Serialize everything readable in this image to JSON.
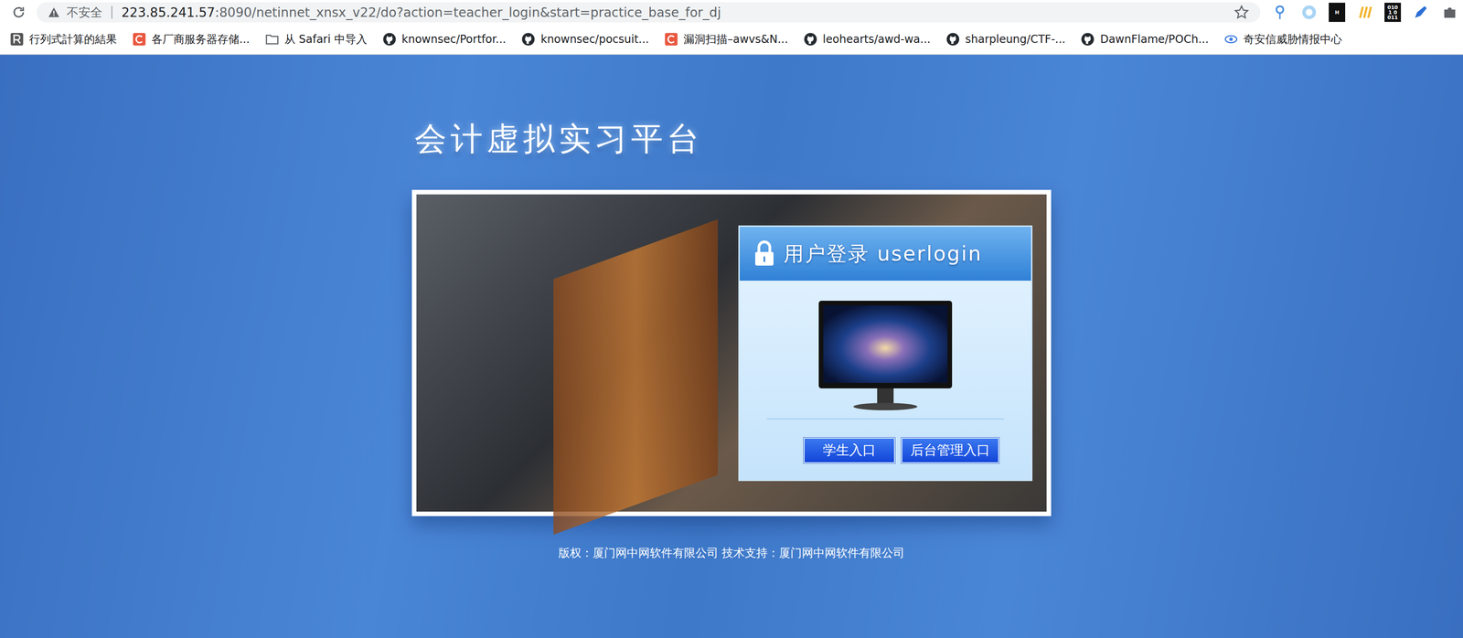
{
  "browser": {
    "security": "不安全",
    "host": "223.85.241.57",
    "path": ":8090/netinnet_xnsx_v22/do?action=teacher_login&start=practice_base_for_dj"
  },
  "extensions": [
    {
      "kind": "pin",
      "label": ""
    },
    {
      "kind": "ring",
      "label": ""
    },
    {
      "kind": "text",
      "label": "H"
    },
    {
      "kind": "stripes",
      "label": ""
    },
    {
      "kind": "text",
      "label": "0101 0011"
    },
    {
      "kind": "pen",
      "label": ""
    },
    {
      "kind": "puzzle",
      "label": ""
    }
  ],
  "bookmarks": [
    {
      "label": "行列式計算的結果",
      "kind": "r"
    },
    {
      "label": "各厂商服务器存储...",
      "kind": "c"
    },
    {
      "label": "从 Safari 中导入",
      "kind": "folder"
    },
    {
      "label": "knownsec/Portfor...",
      "kind": "github"
    },
    {
      "label": "knownsec/pocsuit...",
      "kind": "github"
    },
    {
      "label": "漏洞扫描–awvs&N...",
      "kind": "c"
    },
    {
      "label": "leohearts/awd-wa...",
      "kind": "github"
    },
    {
      "label": "sharpleung/CTF-...",
      "kind": "github"
    },
    {
      "label": "DawnFlame/POCh...",
      "kind": "github"
    },
    {
      "label": "奇安信威胁情报中心",
      "kind": "eye"
    }
  ],
  "page": {
    "title": "会计虚拟实习平台",
    "login": {
      "heading": "用户登录 userlogin",
      "buttons": [
        {
          "label": "学生入口"
        },
        {
          "label": "后台管理入口"
        }
      ]
    },
    "footer": "版权：厦门网中网软件有限公司 技术支持：厦门网中网软件有限公司"
  }
}
